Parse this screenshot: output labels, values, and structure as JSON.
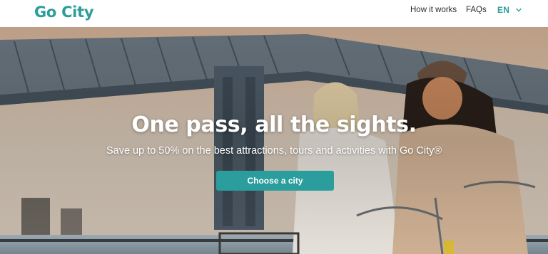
{
  "header": {
    "logo_text": "Go City",
    "nav": {
      "how_it_works": "How it works",
      "faqs": "FAQs"
    },
    "language": {
      "selected": "EN",
      "icon": "chevron-down-icon"
    }
  },
  "hero": {
    "headline": "One pass, all the sights.",
    "subheadline": "Save up to 50% on the best attractions, tours and activities with Go City®",
    "cta_label": "Choose a city"
  },
  "colors": {
    "brand": "#2a9d9c",
    "nav_text": "#2b2b2b",
    "hero_text": "#ffffff"
  }
}
